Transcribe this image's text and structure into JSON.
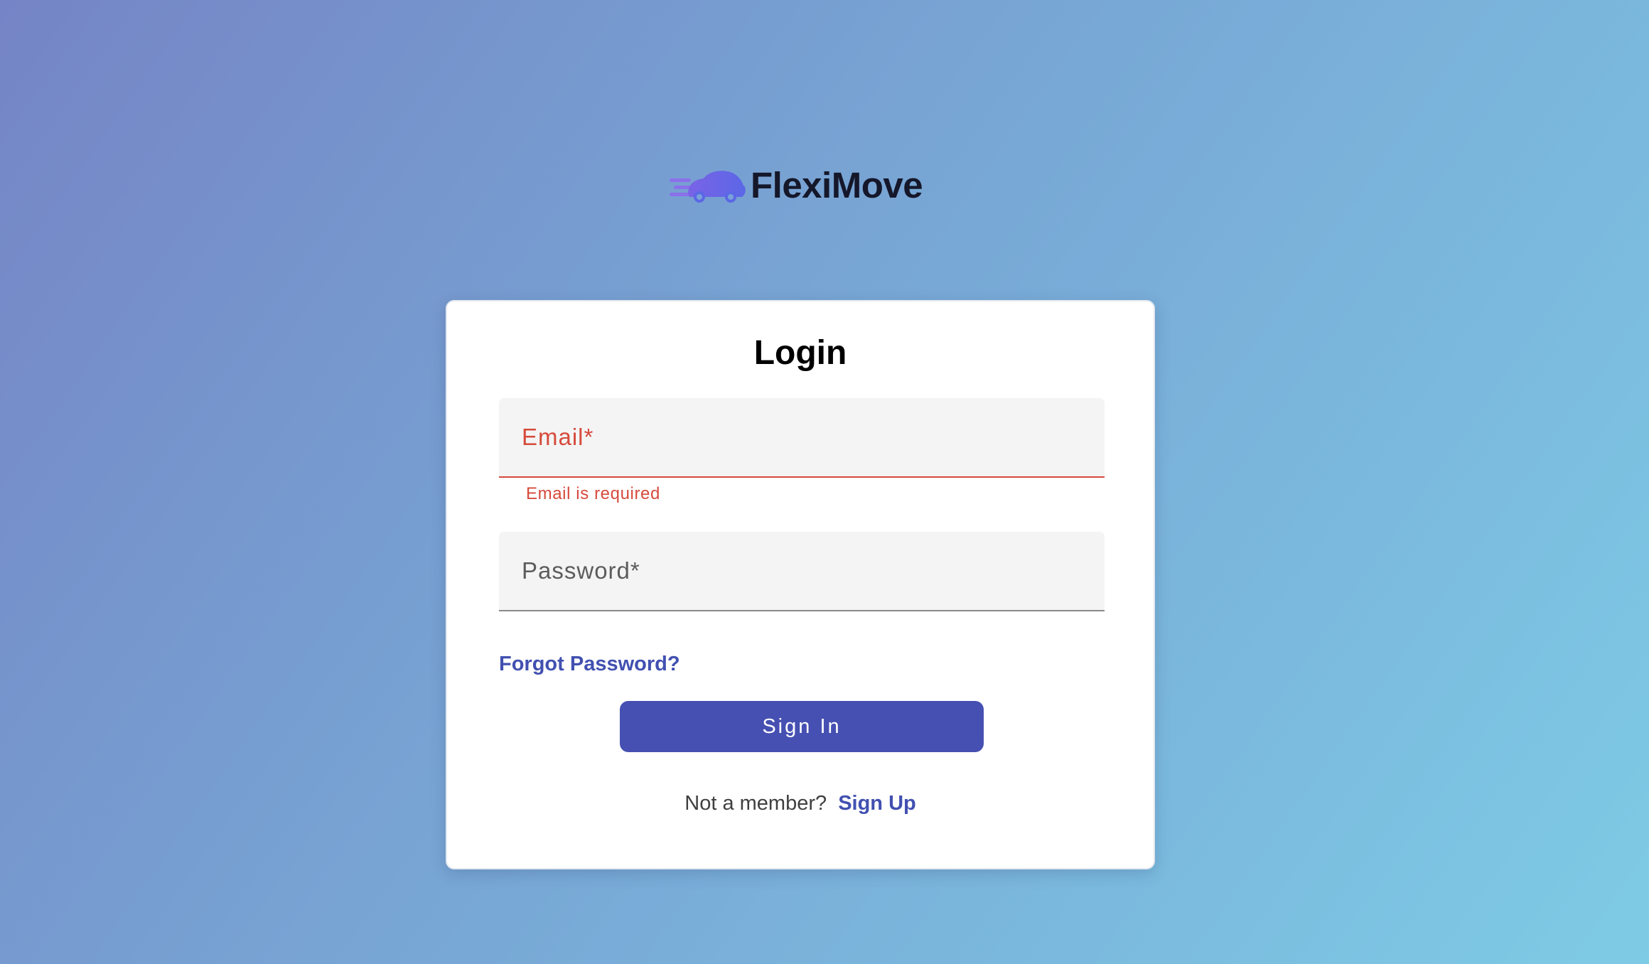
{
  "brand": {
    "name": "FlexiMove",
    "logo_icon": "speeding-car-icon",
    "icon_gradient": [
      "#6a5de0",
      "#5b8ae8"
    ]
  },
  "login": {
    "title": "Login",
    "email": {
      "label": "Email*",
      "value": "",
      "error": "Email is required"
    },
    "password": {
      "label": "Password*",
      "value": ""
    },
    "forgot_password": "Forgot Password?",
    "sign_in": "Sign In",
    "signup_prompt": "Not a member?",
    "signup_link": "Sign Up"
  },
  "colors": {
    "primary": "#4650b2",
    "link": "#4150b0",
    "error": "#d64a3c",
    "background_start": "#7584c6",
    "background_end": "#7ecbe5"
  }
}
